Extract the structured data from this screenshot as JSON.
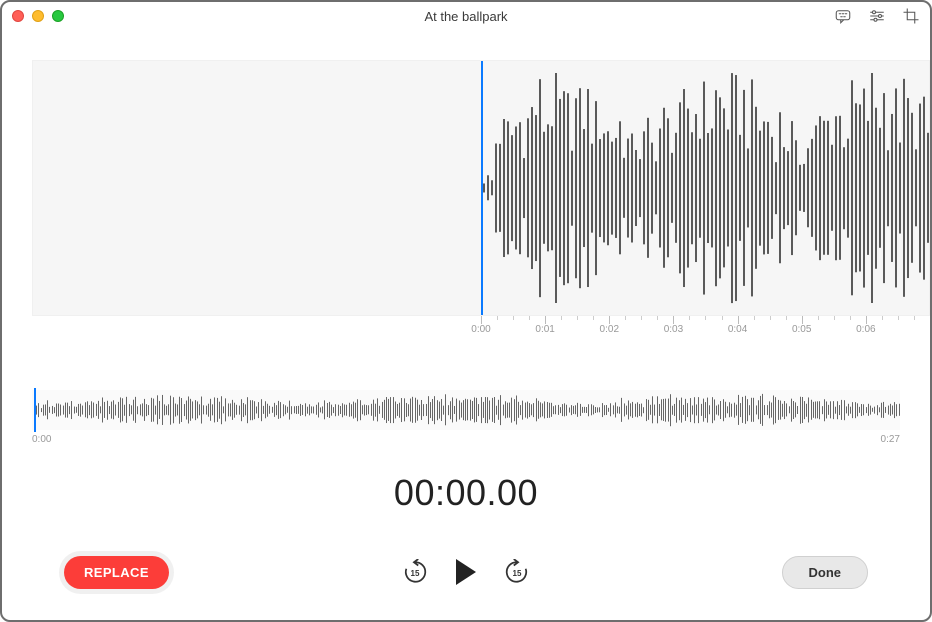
{
  "window": {
    "title": "At the ballpark"
  },
  "toolbar_icons": {
    "transcribe": "speech-bubble-icon",
    "settings": "sliders-icon",
    "trim": "crop-icon"
  },
  "main_ruler": {
    "ticks": [
      "0:00",
      "0:01",
      "0:02",
      "0:03",
      "0:04",
      "0:05",
      "0:06"
    ]
  },
  "overview": {
    "start": "0:00",
    "end": "0:27"
  },
  "timer": "00:00.00",
  "controls": {
    "replace_label": "REPLACE",
    "skip_back_seconds": "15",
    "skip_forward_seconds": "15",
    "done_label": "Done"
  }
}
